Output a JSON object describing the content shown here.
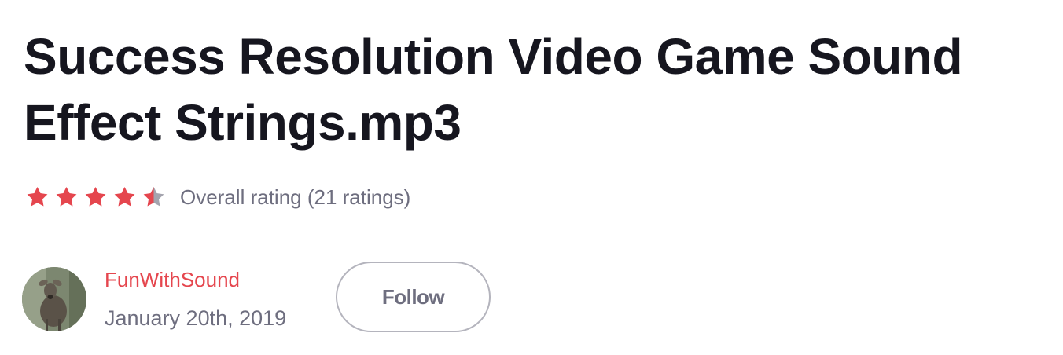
{
  "title": "Success Resolution Video Game Sound Effect Strings.mp3",
  "rating": {
    "value": 4.5,
    "max": 5,
    "text": "Overall rating (21 ratings)",
    "filled_color": "#e5464e",
    "empty_color": "#a4a4ae"
  },
  "author": {
    "name": "FunWithSound",
    "date": "January 20th, 2019",
    "avatar_icon": "deer-photo-avatar"
  },
  "follow_button": {
    "label": "Follow"
  }
}
